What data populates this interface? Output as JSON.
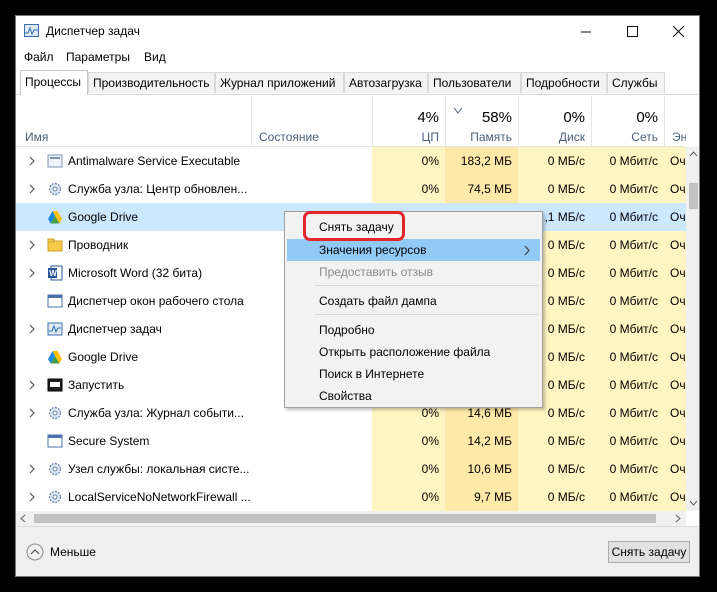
{
  "window": {
    "title": "Диспетчер задач",
    "controls": [
      "minimize",
      "maximize",
      "close"
    ]
  },
  "menu": [
    "Файл",
    "Параметры",
    "Вид"
  ],
  "tabs": [
    "Процессы",
    "Производительность",
    "Журнал приложений",
    "Автозагрузка",
    "Пользователи",
    "Подробности",
    "Службы"
  ],
  "active_tab": "Процессы",
  "columns": {
    "name": "Имя",
    "status": "Состояние",
    "cpu": {
      "pct": "4%",
      "label": "ЦП"
    },
    "memory": {
      "pct": "58%",
      "label": "Память"
    },
    "disk": {
      "pct": "0%",
      "label": "Диск"
    },
    "network": {
      "pct": "0%",
      "label": "Сеть"
    },
    "energy": {
      "label": "Энер"
    }
  },
  "rows": [
    {
      "name": "Antimalware Service Executable",
      "icon": "service-icon",
      "expand": true,
      "cpu": "0%",
      "mem": "183,2 МБ",
      "disk": "0 МБ/с",
      "net": "0 Мбит/с",
      "energy": "Оч"
    },
    {
      "name": "Служба узла: Центр обновлен...",
      "icon": "gear-icon",
      "expand": true,
      "cpu": "0%",
      "mem": "74,5 МБ",
      "disk": "0 МБ/с",
      "net": "0 Мбит/с",
      "energy": "Оч"
    },
    {
      "name": "Google Drive",
      "icon": "google-drive-icon",
      "expand": false,
      "cpu": "",
      "mem": "",
      "disk": ",1 МБ/с",
      "net": "0 Мбит/с",
      "energy": "Оч",
      "selected": true
    },
    {
      "name": "Проводник",
      "icon": "folder-icon",
      "expand": true,
      "cpu": "",
      "mem": "",
      "disk": "0 МБ/с",
      "net": "0 Мбит/с",
      "energy": "Оч"
    },
    {
      "name": "Microsoft Word (32 бита)",
      "icon": "word-icon",
      "expand": true,
      "cpu": "",
      "mem": "",
      "disk": "0 МБ/с",
      "net": "0 Мбит/с",
      "energy": "Оч"
    },
    {
      "name": "Диспетчер окон рабочего стола",
      "icon": "window-icon",
      "expand": false,
      "cpu": "",
      "mem": "",
      "disk": "0 МБ/с",
      "net": "0 Мбит/с",
      "energy": "Оч"
    },
    {
      "name": "Диспетчер задач",
      "icon": "task-manager-icon",
      "expand": true,
      "cpu": "",
      "mem": "",
      "disk": "0 МБ/с",
      "net": "0 Мбит/с",
      "energy": "Оч"
    },
    {
      "name": "Google Drive",
      "icon": "google-drive-icon",
      "expand": false,
      "cpu": "",
      "mem": "",
      "disk": "0 МБ/с",
      "net": "0 Мбит/с",
      "energy": "Оч"
    },
    {
      "name": "Запустить",
      "icon": "run-icon",
      "expand": true,
      "cpu": "",
      "mem": "",
      "disk": "0 МБ/с",
      "net": "0 Мбит/с",
      "energy": "Оч"
    },
    {
      "name": "Служба узла: Журнал событи...",
      "icon": "gear-icon",
      "expand": true,
      "cpu": "0%",
      "mem": "14,6 МБ",
      "disk": "0 МБ/с",
      "net": "0 Мбит/с",
      "energy": "Оч"
    },
    {
      "name": "Secure System",
      "icon": "window-icon",
      "expand": false,
      "cpu": "0%",
      "mem": "14,2 МБ",
      "disk": "0 МБ/с",
      "net": "0 Мбит/с",
      "energy": "Оч"
    },
    {
      "name": "Узел службы: локальная систе...",
      "icon": "gear-icon",
      "expand": true,
      "cpu": "0%",
      "mem": "10,6 МБ",
      "disk": "0 МБ/с",
      "net": "0 Мбит/с",
      "energy": "Оч"
    },
    {
      "name": "LocalServiceNoNetworkFirewall ...",
      "icon": "gear-icon",
      "expand": true,
      "cpu": "0%",
      "mem": "9,7 МБ",
      "disk": "0 МБ/с",
      "net": "0 Мбит/с",
      "energy": "Оч"
    }
  ],
  "context_menu": {
    "items": [
      {
        "label": "Снять задачу",
        "state": "normal"
      },
      {
        "label": "Значения ресурсов",
        "state": "highlighted",
        "submenu": true
      },
      {
        "label": "Предоставить отзыв",
        "state": "disabled"
      },
      {
        "label": "Создать файл дампа",
        "state": "normal"
      },
      {
        "label": "Подробно",
        "state": "normal"
      },
      {
        "label": "Открыть расположение файла",
        "state": "normal"
      },
      {
        "label": "Поиск в Интернете",
        "state": "normal"
      },
      {
        "label": "Свойства",
        "state": "normal"
      }
    ],
    "highlight_color": "#91c9f7",
    "annotation_color": "#e3262b"
  },
  "footer": {
    "less_label": "Меньше",
    "end_task_label": "Снять задачу"
  },
  "colors": {
    "cpu_column": "#fff5c2",
    "memory_column": "#ffe9a8",
    "selected_row": "#cce8ff"
  }
}
